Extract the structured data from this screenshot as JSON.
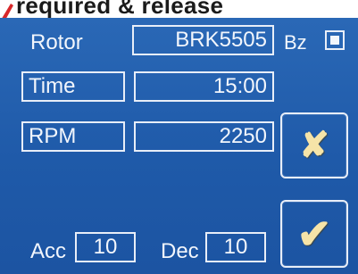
{
  "caption": "required & release",
  "rotor": {
    "label": "Rotor",
    "value": "BRK5505"
  },
  "bz": {
    "label": "Bz",
    "checked": true
  },
  "time": {
    "label": "Time",
    "value": "15:00"
  },
  "rpm": {
    "label": "RPM",
    "value": "2250"
  },
  "acc": {
    "label": "Acc",
    "value": "10"
  },
  "dec": {
    "label": "Dec",
    "value": "10"
  },
  "buttons": {
    "cancel_glyph": "✘",
    "confirm_glyph": "✔"
  },
  "colors": {
    "panel": "#1f5aa9",
    "border": "#e8eef8",
    "glyph": "#f6e4a8"
  }
}
